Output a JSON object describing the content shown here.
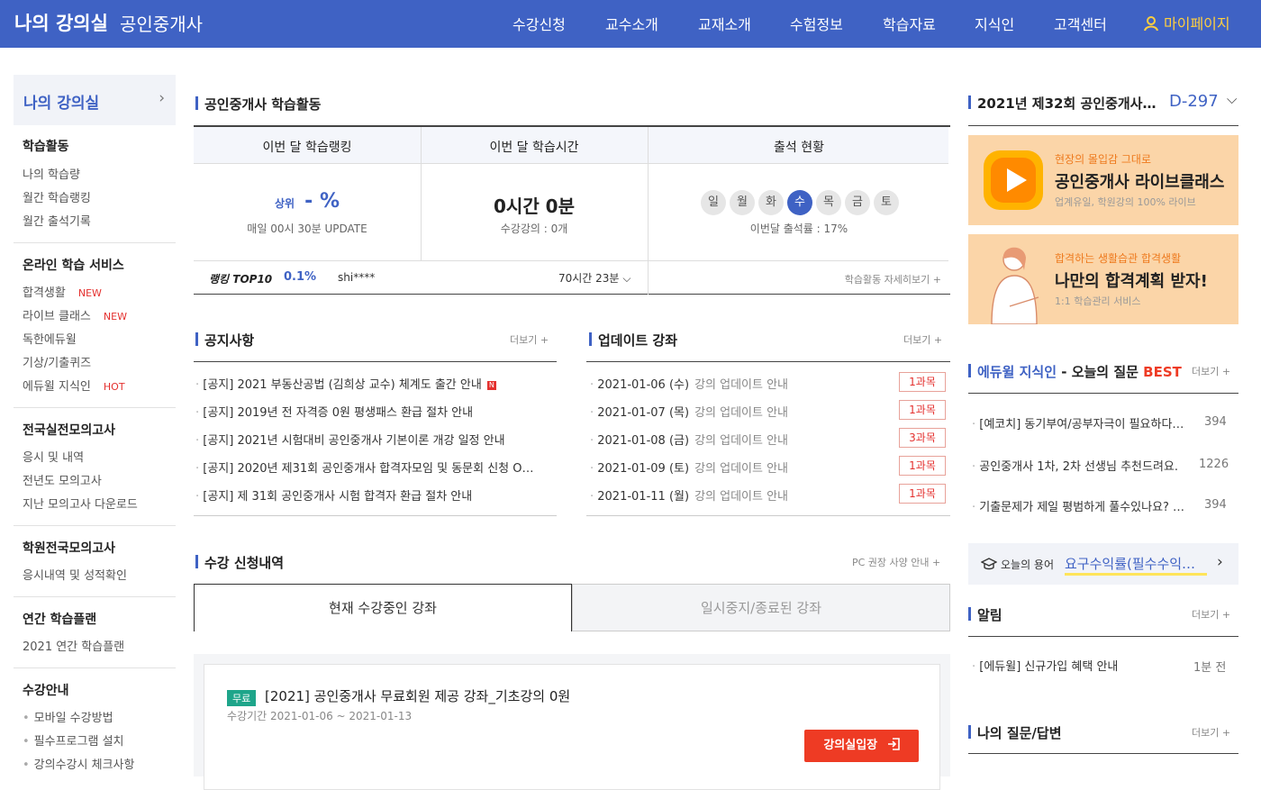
{
  "header": {
    "brand": "나의 강의실",
    "subtitle": "공인중개사",
    "nav": [
      "수강신청",
      "교수소개",
      "교재소개",
      "수험정보",
      "학습자료",
      "지식인",
      "고객센터"
    ],
    "mypage": "마이페이지"
  },
  "sidebar": {
    "title": "나의 강의실",
    "sections": [
      {
        "title": "학습활동",
        "items": [
          "나의 학습량",
          "월간 학습랭킹",
          "월간 출석기록"
        ]
      },
      {
        "title": "온라인 학습 서비스",
        "items": [
          "합격생활",
          "라이브 클래스",
          "독한에듀윌",
          "기상/기출퀴즈",
          "에듀윌 지식인"
        ],
        "badges": [
          "NEW",
          "NEW",
          "",
          "",
          "HOT"
        ]
      },
      {
        "title": "전국실전모의고사",
        "items": [
          "응시 및 내역",
          "전년도 모의고사",
          "지난 모의고사 다운로드"
        ]
      },
      {
        "title": "학원전국모의고사",
        "items": [
          "응시내역 및 성적확인"
        ]
      },
      {
        "title": "연간 학습플랜",
        "items": [
          "2021 연간 학습플랜"
        ]
      },
      {
        "title": "수강안내",
        "items": [
          "모바일 수강방법",
          "필수프로그램 설치",
          "강의수강시 체크사항"
        ]
      }
    ]
  },
  "activity": {
    "title": "공인중개사 학습활동",
    "cols": [
      "이번 달 학습랭킹",
      "이번 달 학습시간",
      "출석 현황"
    ],
    "rank_prefix": "상위",
    "rank_value": "- %",
    "rank_update": "매일 00시 30분 UPDATE",
    "time_value": "0시간 0분",
    "time_sub": "수강강의 : 0개",
    "days": [
      "일",
      "월",
      "화",
      "수",
      "목",
      "금",
      "토"
    ],
    "today_index": 3,
    "attendance": "이번달 출석률 : 17%",
    "top10_label": "랭킹 TOP10",
    "top10_pct": "0.1%",
    "top10_user": "shi****",
    "top10_time": "70시간 23분",
    "detail": "학습활동 자세히보기 +"
  },
  "notice": {
    "title": "공지사항",
    "more": "더보기 +",
    "items": [
      "[공지] 2021 부동산공법 (김희상 교수) 체계도 출간 안내",
      "[공지] 2019년 전 자격증 0원 평생패스 환급 절차 안내",
      "[공지] 2021년 시험대비 공인중개사 기본이론 개강 일정 안내",
      "[공지] 2020년 제31회 공인중개사 합격자모임 및 동문회 신청 O…",
      "[공지] 제 31회 공인중개사 시험 합격자 환급 절차 안내"
    ]
  },
  "updates": {
    "title": "업데이트 강좌",
    "more": "더보기 +",
    "items": [
      {
        "date": "2021-01-06 (수)",
        "text": "강의 업데이트 안내",
        "count": "1과목"
      },
      {
        "date": "2021-01-07 (목)",
        "text": "강의 업데이트 안내",
        "count": "1과목"
      },
      {
        "date": "2021-01-08 (금)",
        "text": "강의 업데이트 안내",
        "count": "3과목"
      },
      {
        "date": "2021-01-09 (토)",
        "text": "강의 업데이트 안내",
        "count": "1과목"
      },
      {
        "date": "2021-01-11 (월)",
        "text": "강의 업데이트 안내",
        "count": "1과목"
      }
    ]
  },
  "enroll": {
    "title": "수강 신청내역",
    "pc_guide": "PC 권장 사양 안내 +",
    "tab_active": "현재 수강중인 강좌",
    "tab_inactive": "일시중지/종료된 강좌",
    "course": {
      "tag": "무료",
      "title": "[2021] 공인중개사 무료회원 제공 강좌_기초강의 0원",
      "period": "수강기간 2021-01-06 ~ 2021-01-13",
      "enter": "강의실입장"
    }
  },
  "right": {
    "dday_title": "2021년 제32회 공인중개사…",
    "dday": "D-297",
    "banner1": {
      "small": "현장의 몰입감 그대로",
      "big": "공인중개사 라이브클래스",
      "sub": "업계유일, 학원강의 100% 라이브"
    },
    "banner2": {
      "small": "합격하는 생활습관 합격생활",
      "big": "나만의 합격계획 받자!",
      "sub": "1:1 학습관리 서비스"
    },
    "qna_title_a": "에듀윌 지식인",
    "qna_title_b": " - 오늘의 질문 ",
    "qna_title_c": "BEST",
    "qna_more": "더보기 +",
    "qna": [
      {
        "q": "[예코치] 동기부여/공부자극이 필요하다…",
        "n": "394"
      },
      {
        "q": "공인중개사 1차, 2차 선생님 추천드려요.",
        "n": "1226"
      },
      {
        "q": "기출문제가 제일 평범하게 풀수있나요? …",
        "n": "394"
      }
    ],
    "term_label": "오늘의 용어",
    "term": "요구수익률(필수수익…",
    "alarm_title": "알림",
    "alarm_more": "더보기 +",
    "alarm_item": "[에듀윌] 신규가입 혜택 안내",
    "alarm_time": "1분 전",
    "myqna_title": "나의 질문/답변",
    "myqna_more": "더보기 +"
  },
  "colors": {
    "primary": "#3f62c4",
    "accent": "#ee3b24",
    "free": "#1ea58a",
    "mypage": "#ffcf3f"
  }
}
